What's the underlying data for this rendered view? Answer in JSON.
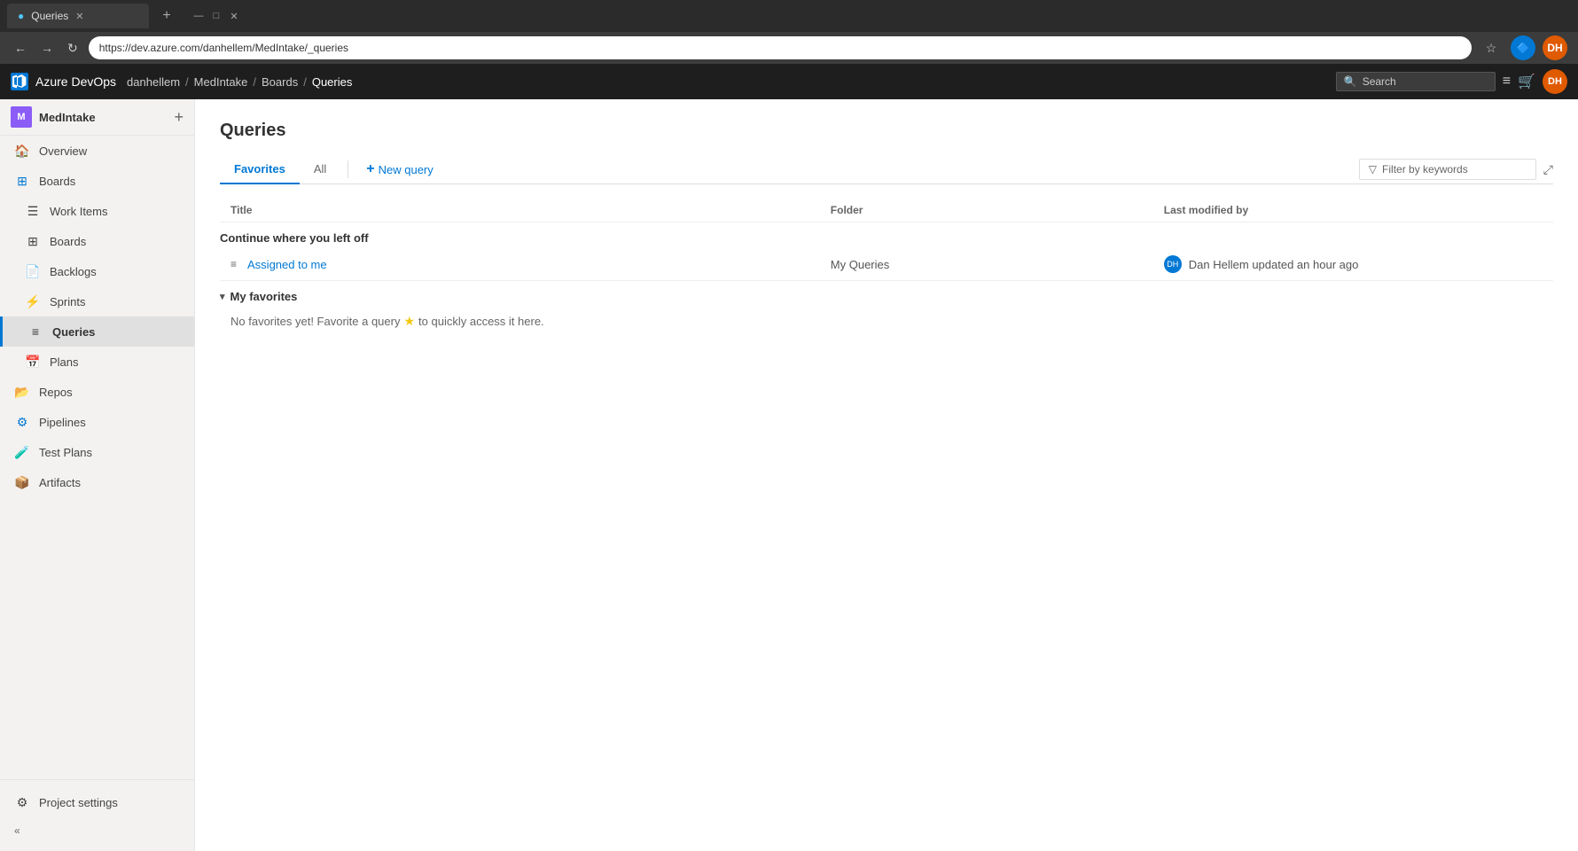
{
  "browser": {
    "tab_title": "Queries",
    "tab_favicon": "Q",
    "url": "https://dev.azure.com/danhellem/MedIntake/_queries",
    "back_btn": "←",
    "forward_btn": "→",
    "refresh_btn": "↻",
    "new_tab_icon": "+",
    "star_icon": "☆",
    "user_icon_label": "DH",
    "extension_icon": "🔷",
    "win_min": "—",
    "win_max": "□",
    "win_close": "✕"
  },
  "topbar": {
    "logo_text": "Azure DevOps",
    "breadcrumbs": [
      "danhellem",
      "MedIntake",
      "Boards",
      "Queries"
    ],
    "search_placeholder": "Search",
    "collections_icon": "≡",
    "basket_icon": "🛒",
    "avatar_initials": "DH"
  },
  "sidebar": {
    "project_name": "MedIntake",
    "project_initial": "M",
    "add_icon": "+",
    "nav_items": [
      {
        "id": "overview",
        "label": "Overview",
        "icon": "🏠"
      },
      {
        "id": "boards",
        "label": "Boards",
        "icon": "📋"
      },
      {
        "id": "work-items",
        "label": "Work Items",
        "icon": "☰"
      },
      {
        "id": "boards-sub",
        "label": "Boards",
        "icon": "⊞"
      },
      {
        "id": "backlogs",
        "label": "Backlogs",
        "icon": "📄"
      },
      {
        "id": "sprints",
        "label": "Sprints",
        "icon": "⚡"
      },
      {
        "id": "queries",
        "label": "Queries",
        "icon": "≡"
      },
      {
        "id": "plans",
        "label": "Plans",
        "icon": "📅"
      },
      {
        "id": "repos",
        "label": "Repos",
        "icon": "📂"
      },
      {
        "id": "pipelines",
        "label": "Pipelines",
        "icon": "⚙"
      },
      {
        "id": "test-plans",
        "label": "Test Plans",
        "icon": "🧪"
      },
      {
        "id": "artifacts",
        "label": "Artifacts",
        "icon": "📦"
      }
    ],
    "active_item": "queries",
    "collapse_label": "«",
    "project_settings": "Project settings"
  },
  "content": {
    "page_title": "Queries",
    "tabs": [
      {
        "id": "favorites",
        "label": "Favorites",
        "active": true
      },
      {
        "id": "all",
        "label": "All",
        "active": false
      }
    ],
    "new_query_label": "New query",
    "filter_placeholder": "Filter by keywords",
    "expand_icon": "⤢",
    "table_headers": {
      "title": "Title",
      "folder": "Folder",
      "last_modified": "Last modified by"
    },
    "sections": [
      {
        "id": "continue",
        "title": "Continue where you left off",
        "collapsible": false,
        "rows": [
          {
            "icon": "≡",
            "title": "Assigned to me",
            "folder": "My Queries",
            "avatar_initials": "DH",
            "last_modified": "Dan Hellem updated an hour ago"
          }
        ]
      },
      {
        "id": "my-favorites",
        "title": "My favorites",
        "collapsible": true,
        "collapsed": false,
        "no_items_text": "No favorites yet! Favorite a query",
        "no_items_suffix": "to quickly access it here."
      }
    ]
  }
}
